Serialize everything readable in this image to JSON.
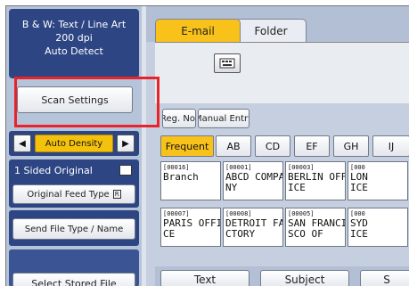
{
  "status": {
    "line1": "B & W: Text / Line Art",
    "line2": "200 dpi",
    "line3": "Auto Detect"
  },
  "left": {
    "scan_settings": "Scan Settings",
    "density_label": "Auto Density",
    "density_left_arrow": "◀",
    "density_right_arrow": "▶",
    "original_label": "1 Sided Original",
    "original_feed_type": "Original Feed Type",
    "original_icon_text": "R",
    "send_file_type": "Send File Type / Name",
    "select_stored_file": "Select Stored File"
  },
  "tabs": {
    "email": "E-mail",
    "folder": "Folder"
  },
  "address": {
    "reg_no": "Reg. No.",
    "manual_entry": "Manual Entry"
  },
  "index_tabs": [
    "Frequent",
    "AB",
    "CD",
    "EF",
    "GH",
    "IJ"
  ],
  "destinations": [
    {
      "num": "[00016]",
      "name": "Branch"
    },
    {
      "num": "[00001]",
      "name": "ABCD COMPA\nNY"
    },
    {
      "num": "[00003]",
      "name": "BERLIN OFF\nICE"
    },
    {
      "num": "[000",
      "name": "LON\nICE"
    },
    {
      "num": "[00007]",
      "name": "PARIS OFFI\nCE"
    },
    {
      "num": "[00008]",
      "name": "DETROIT FA\nCTORY"
    },
    {
      "num": "[00005]",
      "name": "SAN FRANCI\nSCO OF"
    },
    {
      "num": "[000",
      "name": "SYD\nICE"
    }
  ],
  "bottom": {
    "text": "Text",
    "subject": "Subject",
    "third": "S"
  },
  "colors": {
    "accent_yellow": "#f8c21a",
    "panel_blue": "#2e4584",
    "highlight_red": "#e8232a"
  }
}
